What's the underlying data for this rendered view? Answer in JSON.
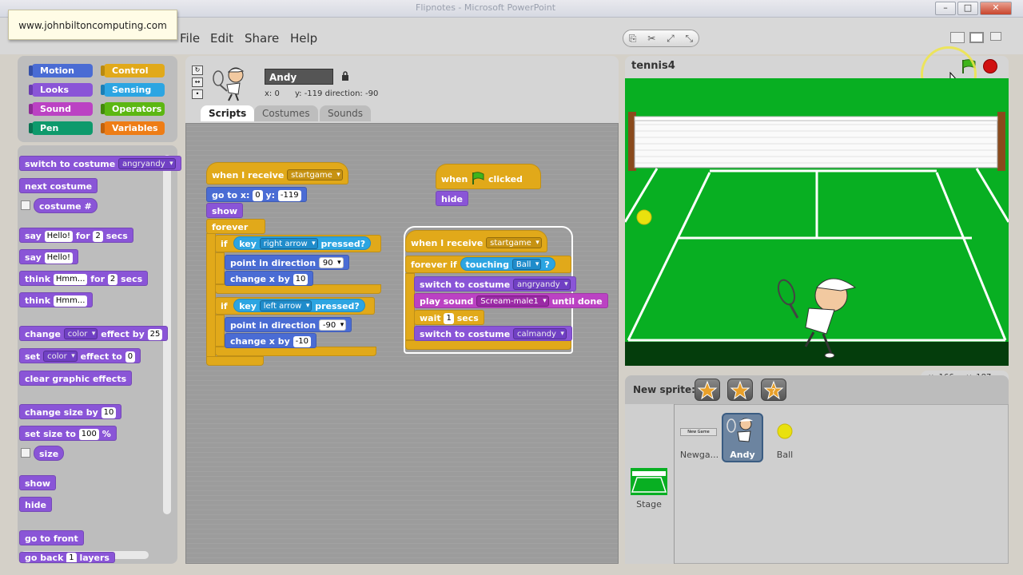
{
  "window": {
    "title": "Flipnotes - Microsoft PowerPoint",
    "buttons": [
      "–",
      "□",
      "✕"
    ]
  },
  "site_label": "www.johnbiltoncomputing.com",
  "menu": [
    "File",
    "Edit",
    "Share",
    "Help"
  ],
  "categories": [
    {
      "label": "Motion",
      "color": "#4a6cd4"
    },
    {
      "label": "Control",
      "color": "#e1a91a"
    },
    {
      "label": "Looks",
      "color": "#8a55d7"
    },
    {
      "label": "Sensing",
      "color": "#2ca5e2"
    },
    {
      "label": "Sound",
      "color": "#bb42c3"
    },
    {
      "label": "Operators",
      "color": "#5cb712"
    },
    {
      "label": "Pen",
      "color": "#0e9a6c"
    },
    {
      "label": "Variables",
      "color": "#ee7d16"
    }
  ],
  "palette": {
    "switch_costume": "switch to costume",
    "switch_costume_val": "angryandy",
    "next_costume": "next costume",
    "costume_num": "costume #",
    "say": "say",
    "say_val": "Hello!",
    "for": "for",
    "secs": "secs",
    "say_secs": "2",
    "say2": "say",
    "say2_val": "Hello!",
    "think": "think",
    "think_val": "Hmm...",
    "think_secs": "2",
    "think2": "think",
    "think2_val": "Hmm...",
    "change": "change",
    "effect_by": "effect by",
    "color": "color",
    "effect_amount": "25",
    "set": "set",
    "effect_to": "effect to",
    "effect_to_val": "0",
    "clear_effects": "clear graphic effects",
    "change_size": "change size by",
    "change_size_val": "10",
    "set_size": "set size to",
    "set_size_val": "100",
    "percent": "%",
    "size": "size",
    "show": "show",
    "hide": "hide",
    "go_front": "go to front",
    "go_back": "go back",
    "go_back_val": "1",
    "layers": "layers"
  },
  "sprite": {
    "name": "Andy",
    "x_label": "x:",
    "x": "0",
    "y_label": "y:",
    "y": "-119",
    "dir_label": "direction:",
    "direction": "-90"
  },
  "tabs": [
    "Scripts",
    "Costumes",
    "Sounds"
  ],
  "scripts": {
    "s1": {
      "hat": "when I receive",
      "hat_val": "startgame",
      "goto": "go to x:",
      "goto_x": "0",
      "goto_y_label": "y:",
      "goto_y": "-119",
      "show": "show",
      "forever": "forever",
      "if1": "if",
      "key1": "key",
      "key1_val": "right arrow",
      "pressed1": "pressed?",
      "point1": "point in direction",
      "point1_val": "90",
      "changex1": "change x by",
      "changex1_val": "10",
      "if2": "if",
      "key2": "key",
      "key2_val": "left arrow",
      "pressed2": "pressed?",
      "point2": "point in direction",
      "point2_val": "-90",
      "changex2": "change x by",
      "changex2_val": "-10"
    },
    "s2": {
      "hat": "when",
      "hat_after": "clicked",
      "hide": "hide"
    },
    "s3": {
      "hat": "when I receive",
      "hat_val": "startgame",
      "forever_if": "forever if",
      "touching": "touching",
      "touching_val": "Ball",
      "q": "?",
      "switch1": "switch to costume",
      "switch1_val": "angryandy",
      "play": "play sound",
      "play_val": "Scream-male1",
      "until_done": "until done",
      "wait": "wait",
      "wait_val": "1",
      "wait_secs": "secs",
      "switch2": "switch to costume",
      "switch2_val": "calmandy"
    }
  },
  "stage": {
    "title": "tennis4",
    "coords_x_label": "x:",
    "coords_x": "166",
    "coords_y_label": "y:",
    "coords_y": "187"
  },
  "new_sprite_label": "New sprite:",
  "sprites": [
    {
      "label": "Newga..."
    },
    {
      "label": "Andy"
    },
    {
      "label": "Ball"
    }
  ],
  "stage_label": "Stage",
  "newgame_thumb": "New Game"
}
